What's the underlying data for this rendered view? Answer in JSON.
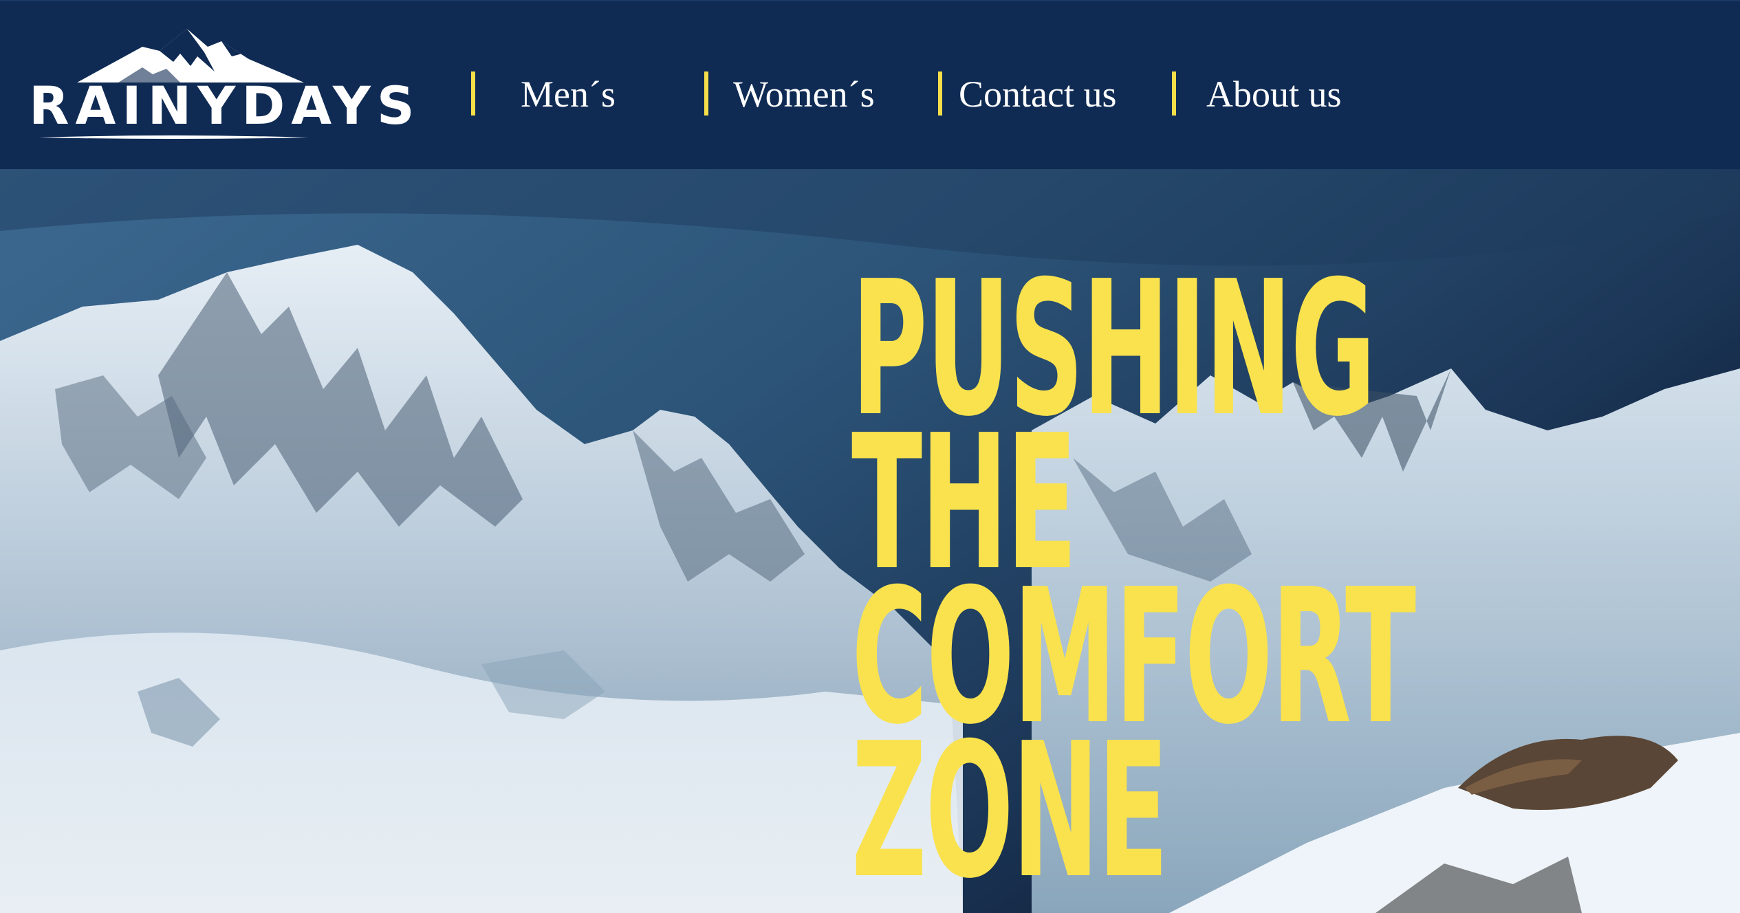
{
  "brand": {
    "name": "RAINYDAYS",
    "logo_icon": "mountain-icon"
  },
  "nav": {
    "items": [
      {
        "label": "Men´s"
      },
      {
        "label": "Women´s"
      },
      {
        "label": "Contact us"
      },
      {
        "label": "About us"
      }
    ]
  },
  "hero": {
    "headline_lines": [
      "PUSHING",
      "THE",
      "COMFORT",
      "ZONE"
    ]
  },
  "colors": {
    "header_bg": "#0f2b54",
    "accent": "#f6de49",
    "headline": "#f9e24d",
    "nav_text": "#ffffff"
  }
}
